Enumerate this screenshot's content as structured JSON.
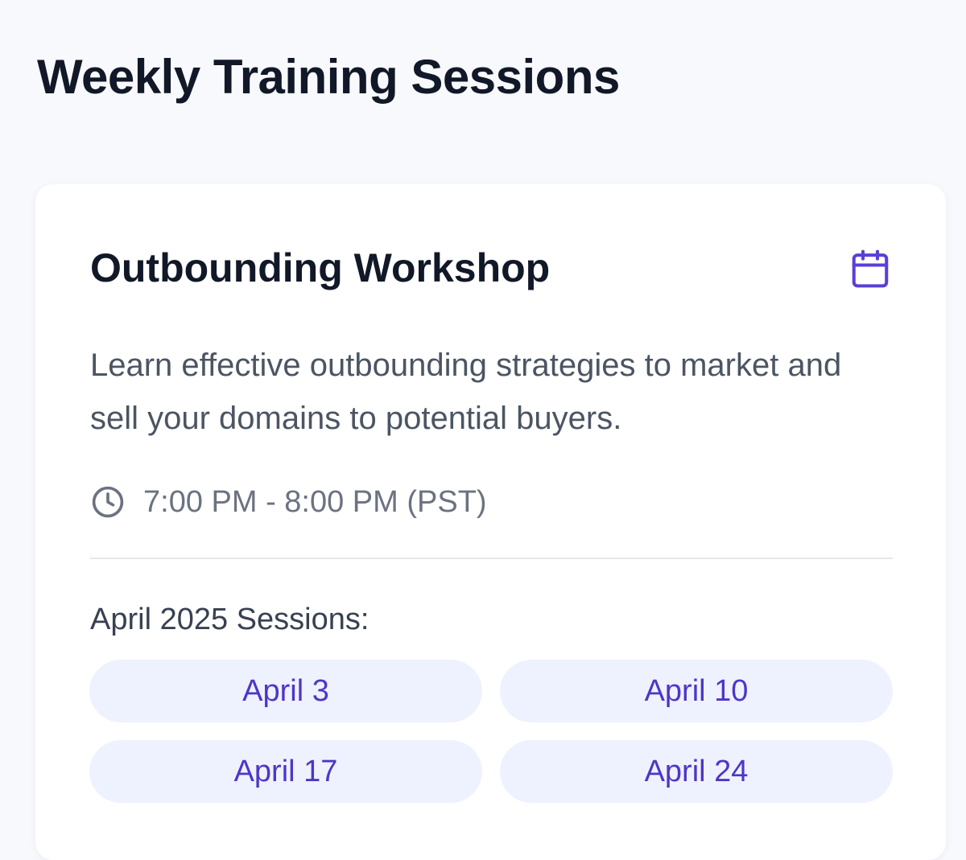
{
  "page": {
    "title": "Weekly Training Sessions"
  },
  "card": {
    "title": "Outbounding Workshop",
    "description": "Learn effective outbounding strategies to market and sell your domains to potential buyers.",
    "time": "7:00 PM - 8:00 PM (PST)",
    "sessions_label": "April 2025 Sessions:",
    "sessions": [
      {
        "label": "April 3"
      },
      {
        "label": "April 10"
      },
      {
        "label": "April 17"
      },
      {
        "label": "April 24"
      }
    ],
    "icons": {
      "header": "calendar-icon",
      "time": "clock-icon"
    }
  },
  "colors": {
    "accent": "#4f35c8",
    "pill_background": "#eef2fe",
    "page_background": "#f8f9fd"
  }
}
